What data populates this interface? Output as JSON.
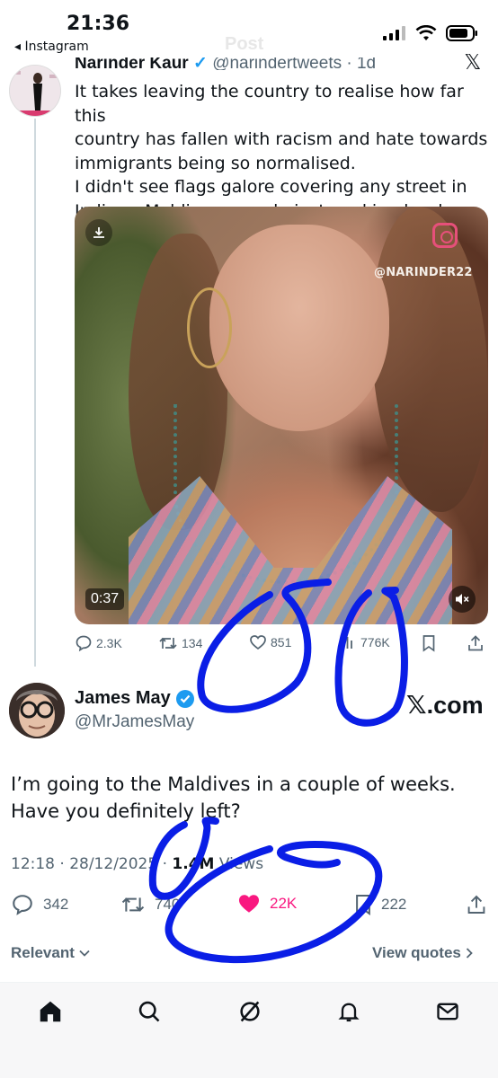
{
  "status_bar": {
    "time": "21:36",
    "back_app": "◂ Instagram",
    "header_title_ghost": "Post"
  },
  "quoted_tweet": {
    "author_name": "Narinder Kaur",
    "handle_time": "@narindertweets · 1d",
    "text": "It takes leaving the country to realise how far this\ncountry has fallen with racism and hate towards\nimmigrants being so normalised.\nI didn't see flags galore covering any street in\nIndia or Maldives..people just working hard.",
    "media": {
      "watermark": "@NARINDER22",
      "duration": "0:37"
    },
    "stats": {
      "replies": "2.3K",
      "reposts": "134",
      "likes": "851",
      "views": "776K"
    }
  },
  "main_tweet": {
    "author_name": "James May",
    "handle": "@MrJamesMay",
    "link_label": ".com",
    "text": "I’m going to the Maldives in a couple of weeks.\nHave you definitely left?",
    "timestamp": "12:18 · 28/12/2025 · ",
    "views_count": "1.4M",
    "views_label": " Views",
    "stats": {
      "replies": "342",
      "reposts": "740",
      "likes": "22K",
      "bookmarks": "222"
    }
  },
  "replies_bar": {
    "sort_label": "Relevant",
    "view_quotes_label": "View quotes"
  },
  "colors": {
    "like_pink": "#f91880",
    "verified_blue": "#1d9bf0",
    "annotation_blue": "#0a1ee6"
  }
}
